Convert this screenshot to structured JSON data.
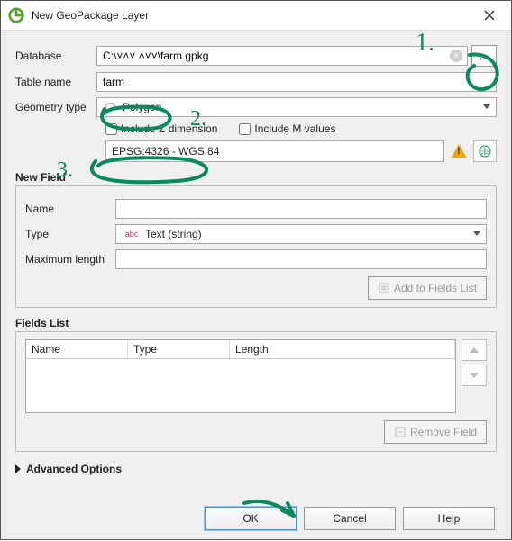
{
  "title": "New GeoPackage Layer",
  "labels": {
    "database": "Database",
    "table_name": "Table name",
    "geometry_type": "Geometry type",
    "include_z": "Include Z dimension",
    "include_m": "Include M values",
    "new_field": "New Field",
    "nf_name": "Name",
    "nf_type": "Type",
    "nf_maxlen": "Maximum length",
    "add_to_fields": "Add to Fields List",
    "fields_list": "Fields List",
    "col_name": "Name",
    "col_type": "Type",
    "col_length": "Length",
    "remove_field": "Remove Field",
    "advanced": "Advanced Options",
    "ok": "OK",
    "cancel": "Cancel",
    "help": "Help"
  },
  "values": {
    "database": "C:\\˅˄˅ ˄˅˅\\farm.gpkg",
    "table_name": "farm",
    "geometry_type": "Polygon",
    "crs": "EPSG:4326 - WGS 84",
    "nf_name": "",
    "nf_type_prefix": "abc",
    "nf_type": "Text (string)",
    "nf_maxlen": ""
  },
  "annotations": {
    "one": "1.",
    "two": "2.",
    "three": "3."
  },
  "browse_dots": "..."
}
